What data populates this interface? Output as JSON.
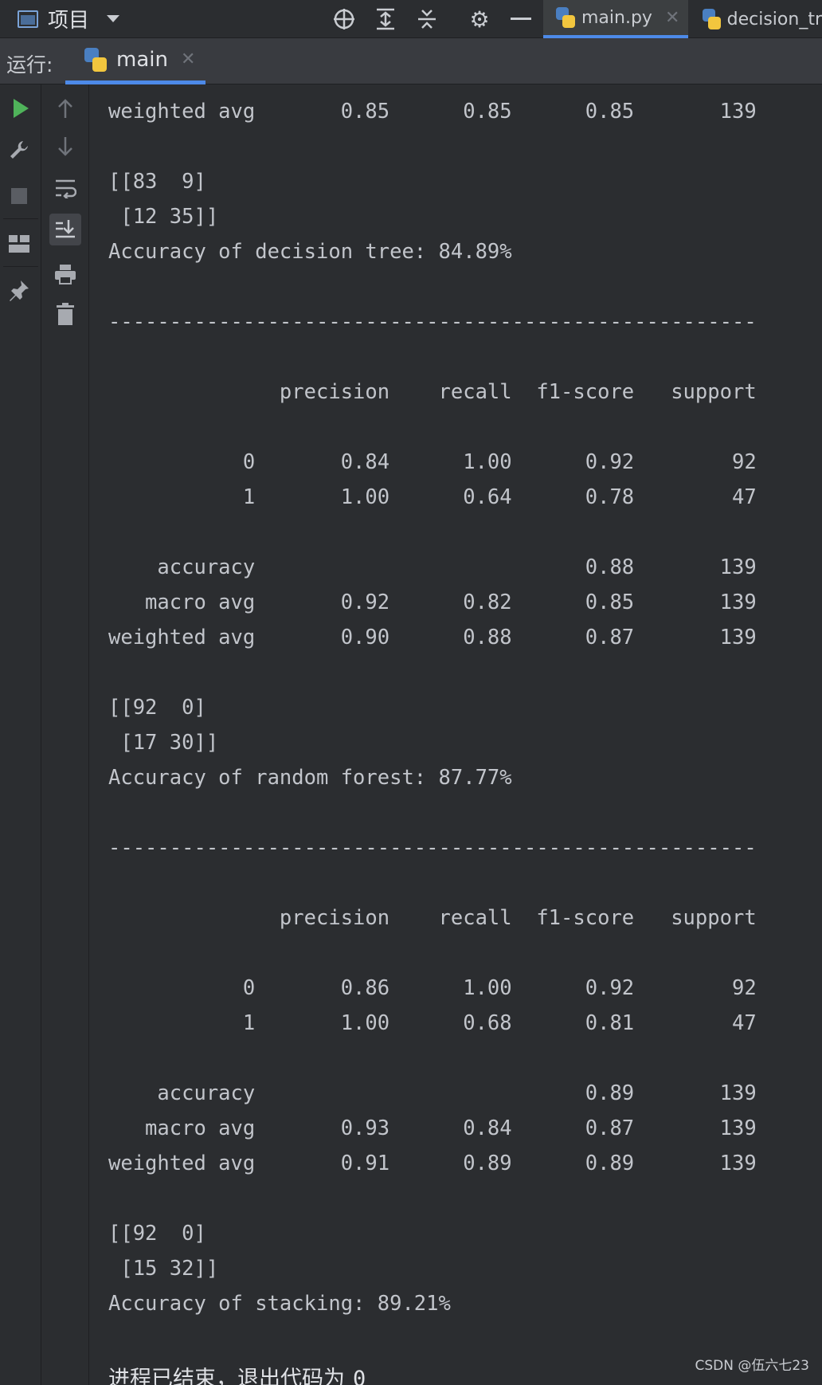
{
  "toolbar": {
    "project_label": "项目",
    "icons": [
      "crosshair-icon",
      "expand-all-icon",
      "collapse-all-icon",
      "gear-icon",
      "minimize-icon"
    ]
  },
  "tabs": [
    {
      "label": "main.py",
      "active": true
    },
    {
      "label": "decision_tr",
      "active": false
    }
  ],
  "run": {
    "label": "运行:",
    "tab_label": "main"
  },
  "console": {
    "output": "weighted avg       0.85      0.85      0.85       139\n\n[[83  9]\n [12 35]]\nAccuracy of decision tree: 84.89%\n\n-----------------------------------------------------\n\n              precision    recall  f1-score   support\n\n           0       0.84      1.00      0.92        92\n           1       1.00      0.64      0.78        47\n\n    accuracy                           0.88       139\n   macro avg       0.92      0.82      0.85       139\nweighted avg       0.90      0.88      0.87       139\n\n[[92  0]\n [17 30]]\nAccuracy of random forest: 87.77%\n\n-----------------------------------------------------\n\n              precision    recall  f1-score   support\n\n           0       0.86      1.00      0.92        92\n           1       1.00      0.68      0.81        47\n\n    accuracy                           0.89       139\n   macro avg       0.93      0.84      0.87       139\nweighted avg       0.91      0.89      0.89       139\n\n[[92  0]\n [15 32]]\nAccuracy of stacking: 89.21%",
    "exit_text": "进程已结束，退出代码为",
    "exit_code": "0"
  },
  "watermark": "CSDN @伍六七23",
  "colors": {
    "accent": "#4d8ae8",
    "run_green": "#4fb35a",
    "background": "#2b2d30"
  }
}
